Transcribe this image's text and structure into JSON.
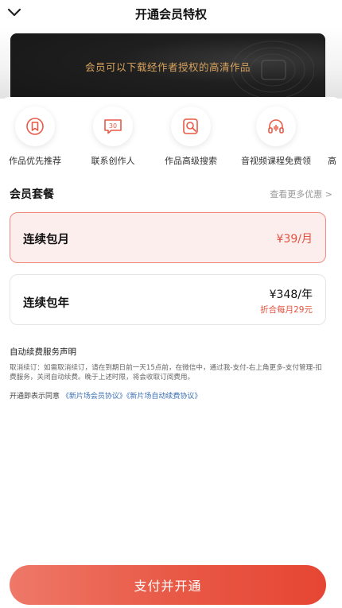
{
  "header": {
    "title": "开通会员特权",
    "back_icon": "chevron-down-icon"
  },
  "hero": {
    "text": "会员可以下载经作者授权的高清作品",
    "text_color": "#d9a35e"
  },
  "privileges": [
    {
      "label": "作品优先推荐",
      "icon": "bookmark-icon"
    },
    {
      "label": "联系创作人",
      "icon": "chat-30-icon"
    },
    {
      "label": "作品高级搜索",
      "icon": "search-doc-icon"
    },
    {
      "label": "音视频课程免费领",
      "icon": "headphones-icon"
    },
    {
      "label": "高",
      "icon": "partial-icon"
    }
  ],
  "plans_section": {
    "title": "会员套餐",
    "more": "查看更多优惠 >"
  },
  "plans": [
    {
      "name": "连续包月",
      "price": "¥39/月",
      "selected": true
    },
    {
      "name": "连续包年",
      "price": "¥348/年",
      "sub": "折合每月29元",
      "selected": false
    }
  ],
  "notice": {
    "title": "自动续费服务声明",
    "body": "取消续订：如需取消续订，请在到期日前一天15点前，在微信中，通过我-支付-右上角更多-支付管理-扣费服务，关闭自动续费。晚于上述时限，将会收取订阅费用。"
  },
  "agreement": {
    "prefix": "开通即表示同意",
    "link1": "《新片场会员协议》",
    "link2": "《新片场自动续费协议》"
  },
  "pay_button": "支付并开通",
  "colors": {
    "accent": "#e85a47",
    "link": "#3b6fb5"
  }
}
